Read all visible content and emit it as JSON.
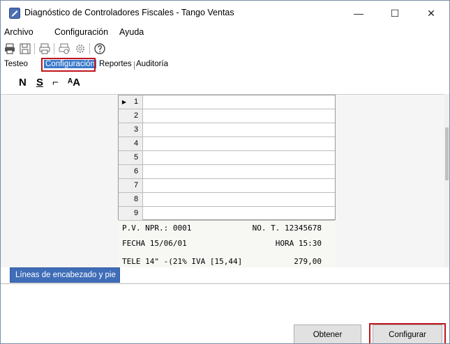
{
  "window": {
    "title": "Diagnóstico de Controladores Fiscales - Tango Ventas",
    "minimize": "—",
    "maximize": "☐",
    "close": "✕"
  },
  "menu": {
    "items": [
      {
        "label": "Archivo"
      },
      {
        "label": "Configuración"
      },
      {
        "label": "Ayuda"
      }
    ]
  },
  "toolbar": {
    "icons": [
      "printer-icon",
      "save-icon",
      "printer-icon",
      "print-setup-icon",
      "settings-gear-icon",
      "help-icon"
    ]
  },
  "tabs": [
    {
      "label": "Testeo",
      "active": false
    },
    {
      "label": "Configuración",
      "active": true
    },
    {
      "label": "Reportes",
      "active": false
    },
    {
      "label": "Auditoría",
      "active": false
    }
  ],
  "format_toolbar": {
    "normal": "N",
    "underline": "S",
    "expanded": "⌐",
    "font_size": "ᴬA"
  },
  "grid": {
    "current_row_marker": "▶",
    "rows": [
      "1",
      "2",
      "3",
      "4",
      "5",
      "6",
      "7",
      "8",
      "9"
    ]
  },
  "ticket": {
    "line1_left": "P.V. NPR.: 0001",
    "line1_right": "NO. T. 12345678",
    "line2_left": "FECHA 15/06/01",
    "line2_right": "HORA 15:30",
    "line3_left": "TELE 14\" -(21% IVA [15,44]",
    "line3_right": "279,00"
  },
  "section": {
    "tab_label": "Líneas de encabezado y pie"
  },
  "buttons": {
    "obtener": "Obtener",
    "configurar": "Configurar"
  },
  "colors": {
    "accent": "#3f6db8",
    "highlight": "#c0141c"
  }
}
